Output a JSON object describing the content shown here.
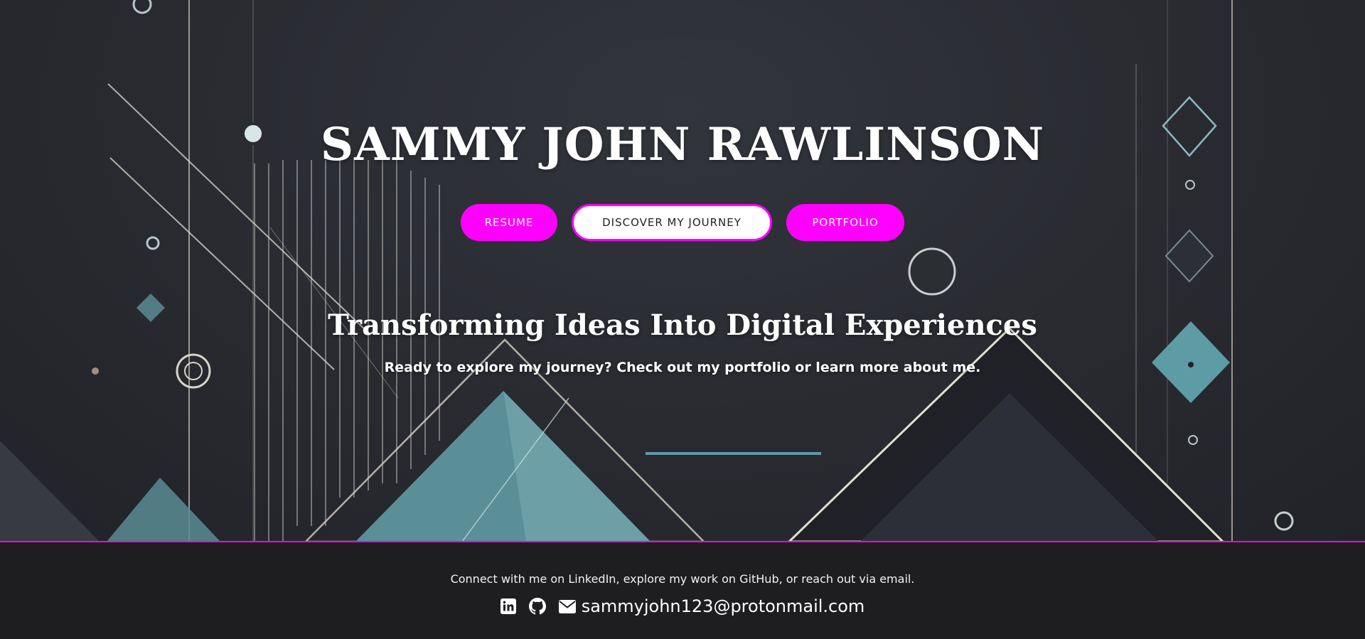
{
  "hero": {
    "title": "SAMMY JOHN RAWLINSON",
    "buttons": {
      "resume": "RESUME",
      "journey": "DISCOVER MY JOURNEY",
      "portfolio": "PORTFOLIO"
    },
    "heading": "Transforming Ideas Into Digital Experiences",
    "tagline": "Ready to explore my journey? Check out my portfolio or learn more about me."
  },
  "footer": {
    "text": "Connect with me on LinkedIn, explore my work on GitHub, or reach out via email.",
    "linkedin_icon": "linkedin-icon",
    "github_icon": "github-icon",
    "email_icon": "envelope-icon",
    "email": "sammyjohn123@protonmail.com"
  },
  "colors": {
    "accent": "#ff00ff",
    "background": "#2a2c32",
    "footer": "#1e1e20",
    "teal": "#5b9aa6"
  }
}
